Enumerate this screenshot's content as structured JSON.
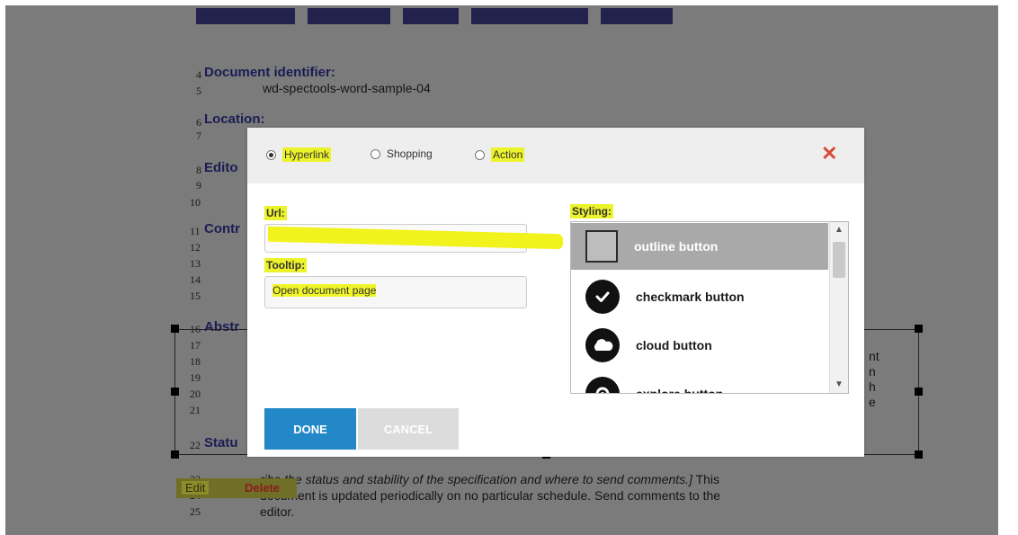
{
  "document": {
    "heading_fragment": "...",
    "line_numbers": [
      "4",
      "5",
      "6",
      "7",
      "8",
      "9",
      "10",
      "11",
      "12",
      "13",
      "14",
      "15",
      "16",
      "17",
      "18",
      "19",
      "20",
      "21",
      "22",
      "23",
      "24",
      "25"
    ],
    "doc_identifier_label": "Document identifier:",
    "doc_identifier_value": "wd-spectools-word-sample-04",
    "location_label": "Location:",
    "editor_label_partial": "Edito",
    "contributors_label_partial": "Contr",
    "abstract_label_partial": "Abstr",
    "status_label_partial": "Statu",
    "status_line1_prefix": "ribe the status and stability of the specification and where to send comments.]",
    "status_line1_suffix": " This",
    "status_line2": "document is updated periodically on no particular schedule. Send comments to the",
    "status_line3": "editor.",
    "clipped_right": [
      "nt",
      "n",
      "h",
      "e"
    ]
  },
  "edit_toolbar": {
    "edit_label": "Edit",
    "delete_label": "Delete"
  },
  "dialog": {
    "radios": [
      {
        "label": "Hyperlink",
        "checked": true,
        "highlighted": true
      },
      {
        "label": "Shopping",
        "checked": false,
        "highlighted": false
      },
      {
        "label": "Action",
        "checked": false,
        "highlighted": true
      }
    ],
    "close_icon": "close-x-icon",
    "url_label": "Url:",
    "url_value": "",
    "tooltip_label": "Tooltip:",
    "tooltip_value": "Open document page",
    "styling_label": "Styling:",
    "styling_options": [
      {
        "label": "outline button",
        "icon": "outline-square-icon",
        "selected": true
      },
      {
        "label": "checkmark button",
        "icon": "checkmark-icon",
        "selected": false
      },
      {
        "label": "cloud button",
        "icon": "cloud-icon",
        "selected": false
      },
      {
        "label": "explore button",
        "icon": "explore-icon",
        "selected": false
      }
    ],
    "done_label": "DONE",
    "cancel_label": "CANCEL"
  },
  "colors": {
    "highlight": "#ecf32a",
    "done_blue": "#2388c8",
    "close_red": "#d84a3a",
    "overlay_gray": "#7b7b7b"
  }
}
